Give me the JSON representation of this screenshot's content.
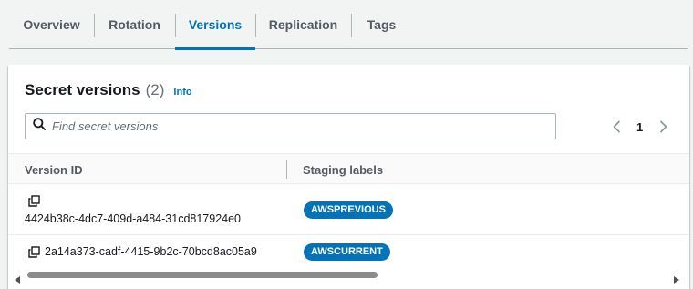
{
  "tabs": [
    {
      "label": "Overview",
      "active": false
    },
    {
      "label": "Rotation",
      "active": false
    },
    {
      "label": "Versions",
      "active": true
    },
    {
      "label": "Replication",
      "active": false
    },
    {
      "label": "Tags",
      "active": false
    }
  ],
  "card": {
    "title": "Secret versions",
    "count": "(2)",
    "info_label": "Info"
  },
  "search": {
    "placeholder": "Find secret versions",
    "value": ""
  },
  "pagination": {
    "current_page": "1"
  },
  "table": {
    "columns": [
      "Version ID",
      "Staging labels"
    ],
    "rows": [
      {
        "version_id": "4424b38c-4dc7-409d-a484-31cd817924e0",
        "staging_label": "AWSPREVIOUS"
      },
      {
        "version_id": "2a14a373-cadf-4415-9b2c-70bcd8ac05a9",
        "staging_label": "AWSCURRENT"
      }
    ]
  },
  "colors": {
    "accent": "#0073bb",
    "badge_bg": "#0073bb",
    "text_secondary": "#545b64"
  },
  "icons": [
    "search-icon",
    "chevron-left-icon",
    "chevron-right-icon",
    "copy-icon",
    "scroll-left-icon",
    "scroll-right-icon"
  ]
}
